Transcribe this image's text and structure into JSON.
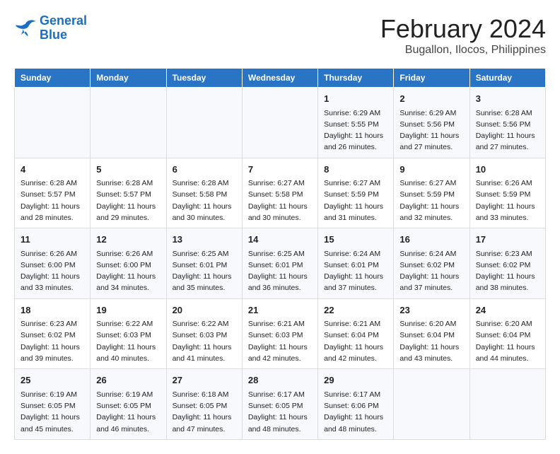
{
  "header": {
    "logo_line1": "General",
    "logo_line2": "Blue",
    "title": "February 2024",
    "subtitle": "Bugallon, Ilocos, Philippines"
  },
  "days_of_week": [
    "Sunday",
    "Monday",
    "Tuesday",
    "Wednesday",
    "Thursday",
    "Friday",
    "Saturday"
  ],
  "weeks": [
    [
      {
        "day": "",
        "content": ""
      },
      {
        "day": "",
        "content": ""
      },
      {
        "day": "",
        "content": ""
      },
      {
        "day": "",
        "content": ""
      },
      {
        "day": "1",
        "content": "Sunrise: 6:29 AM\nSunset: 5:55 PM\nDaylight: 11 hours\nand 26 minutes."
      },
      {
        "day": "2",
        "content": "Sunrise: 6:29 AM\nSunset: 5:56 PM\nDaylight: 11 hours\nand 27 minutes."
      },
      {
        "day": "3",
        "content": "Sunrise: 6:28 AM\nSunset: 5:56 PM\nDaylight: 11 hours\nand 27 minutes."
      }
    ],
    [
      {
        "day": "4",
        "content": "Sunrise: 6:28 AM\nSunset: 5:57 PM\nDaylight: 11 hours\nand 28 minutes."
      },
      {
        "day": "5",
        "content": "Sunrise: 6:28 AM\nSunset: 5:57 PM\nDaylight: 11 hours\nand 29 minutes."
      },
      {
        "day": "6",
        "content": "Sunrise: 6:28 AM\nSunset: 5:58 PM\nDaylight: 11 hours\nand 30 minutes."
      },
      {
        "day": "7",
        "content": "Sunrise: 6:27 AM\nSunset: 5:58 PM\nDaylight: 11 hours\nand 30 minutes."
      },
      {
        "day": "8",
        "content": "Sunrise: 6:27 AM\nSunset: 5:59 PM\nDaylight: 11 hours\nand 31 minutes."
      },
      {
        "day": "9",
        "content": "Sunrise: 6:27 AM\nSunset: 5:59 PM\nDaylight: 11 hours\nand 32 minutes."
      },
      {
        "day": "10",
        "content": "Sunrise: 6:26 AM\nSunset: 5:59 PM\nDaylight: 11 hours\nand 33 minutes."
      }
    ],
    [
      {
        "day": "11",
        "content": "Sunrise: 6:26 AM\nSunset: 6:00 PM\nDaylight: 11 hours\nand 33 minutes."
      },
      {
        "day": "12",
        "content": "Sunrise: 6:26 AM\nSunset: 6:00 PM\nDaylight: 11 hours\nand 34 minutes."
      },
      {
        "day": "13",
        "content": "Sunrise: 6:25 AM\nSunset: 6:01 PM\nDaylight: 11 hours\nand 35 minutes."
      },
      {
        "day": "14",
        "content": "Sunrise: 6:25 AM\nSunset: 6:01 PM\nDaylight: 11 hours\nand 36 minutes."
      },
      {
        "day": "15",
        "content": "Sunrise: 6:24 AM\nSunset: 6:01 PM\nDaylight: 11 hours\nand 37 minutes."
      },
      {
        "day": "16",
        "content": "Sunrise: 6:24 AM\nSunset: 6:02 PM\nDaylight: 11 hours\nand 37 minutes."
      },
      {
        "day": "17",
        "content": "Sunrise: 6:23 AM\nSunset: 6:02 PM\nDaylight: 11 hours\nand 38 minutes."
      }
    ],
    [
      {
        "day": "18",
        "content": "Sunrise: 6:23 AM\nSunset: 6:02 PM\nDaylight: 11 hours\nand 39 minutes."
      },
      {
        "day": "19",
        "content": "Sunrise: 6:22 AM\nSunset: 6:03 PM\nDaylight: 11 hours\nand 40 minutes."
      },
      {
        "day": "20",
        "content": "Sunrise: 6:22 AM\nSunset: 6:03 PM\nDaylight: 11 hours\nand 41 minutes."
      },
      {
        "day": "21",
        "content": "Sunrise: 6:21 AM\nSunset: 6:03 PM\nDaylight: 11 hours\nand 42 minutes."
      },
      {
        "day": "22",
        "content": "Sunrise: 6:21 AM\nSunset: 6:04 PM\nDaylight: 11 hours\nand 42 minutes."
      },
      {
        "day": "23",
        "content": "Sunrise: 6:20 AM\nSunset: 6:04 PM\nDaylight: 11 hours\nand 43 minutes."
      },
      {
        "day": "24",
        "content": "Sunrise: 6:20 AM\nSunset: 6:04 PM\nDaylight: 11 hours\nand 44 minutes."
      }
    ],
    [
      {
        "day": "25",
        "content": "Sunrise: 6:19 AM\nSunset: 6:05 PM\nDaylight: 11 hours\nand 45 minutes."
      },
      {
        "day": "26",
        "content": "Sunrise: 6:19 AM\nSunset: 6:05 PM\nDaylight: 11 hours\nand 46 minutes."
      },
      {
        "day": "27",
        "content": "Sunrise: 6:18 AM\nSunset: 6:05 PM\nDaylight: 11 hours\nand 47 minutes."
      },
      {
        "day": "28",
        "content": "Sunrise: 6:17 AM\nSunset: 6:05 PM\nDaylight: 11 hours\nand 48 minutes."
      },
      {
        "day": "29",
        "content": "Sunrise: 6:17 AM\nSunset: 6:06 PM\nDaylight: 11 hours\nand 48 minutes."
      },
      {
        "day": "",
        "content": ""
      },
      {
        "day": "",
        "content": ""
      }
    ]
  ]
}
